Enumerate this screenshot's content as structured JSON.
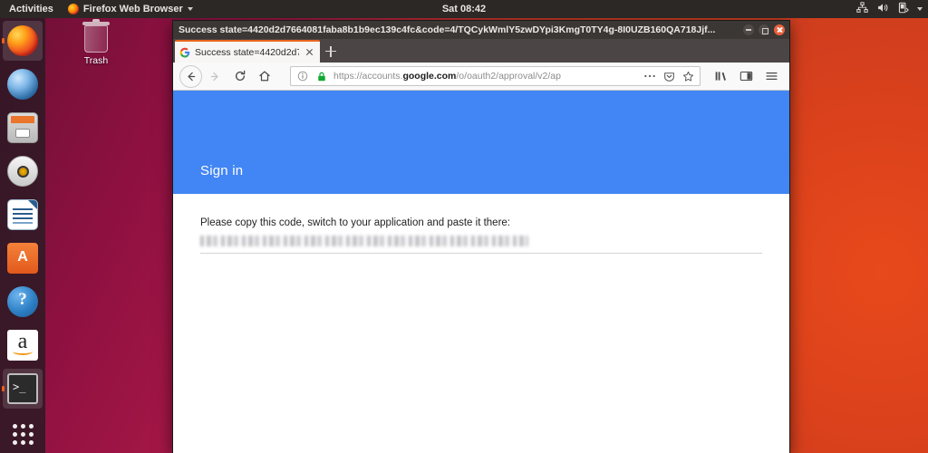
{
  "topbar": {
    "activities": "Activities",
    "app_menu": "Firefox Web Browser",
    "clock": "Sat 08:42",
    "tray_icons": [
      "network-icon",
      "volume-icon",
      "power-icon",
      "chevron-down-icon"
    ]
  },
  "dock": {
    "items": [
      {
        "label": "Firefox Web Browser",
        "icon": "firefox-icon",
        "active": true
      },
      {
        "label": "Thunderbird Mail",
        "icon": "thunderbird-icon",
        "active": false
      },
      {
        "label": "Files",
        "icon": "files-icon",
        "active": false
      },
      {
        "label": "Rhythmbox",
        "icon": "rhythmbox-icon",
        "active": false
      },
      {
        "label": "LibreOffice Writer",
        "icon": "writer-icon",
        "active": false
      },
      {
        "label": "Ubuntu Software",
        "icon": "ubuntu-software-icon",
        "active": false
      },
      {
        "label": "Help",
        "icon": "help-icon",
        "active": false
      },
      {
        "label": "Amazon",
        "icon": "amazon-icon",
        "active": false
      },
      {
        "label": "Terminal",
        "icon": "terminal-icon",
        "active": true
      }
    ],
    "show_applications": "Show Applications"
  },
  "desktop": {
    "trash_label": "Trash"
  },
  "window": {
    "title": "Success state=4420d2d7664081faba8b1b9ec139c4fc&code=4/TQCykWmlY5zwDYpi3KmgT0TY4g-8I0UZB160QA718Jjf...",
    "controls": {
      "minimize": "minimize-button",
      "maximize": "maximize-button",
      "close": "close-button"
    }
  },
  "browser": {
    "tab": {
      "title": "Success state=4420d2d7",
      "favicon": "google-favicon",
      "close_label": "Close tab"
    },
    "new_tab_label": "New tab",
    "nav": {
      "back": "back-button",
      "forward": "forward-button",
      "reload": "reload-button",
      "home": "home-button"
    },
    "urlbar": {
      "url_prefix": "https://accounts.",
      "url_domain": "google.com",
      "url_suffix": "/o/oauth2/approval/v2/ap",
      "full_url": "https://accounts.google.com/o/oauth2/approval/v2/ap",
      "identity_icon": "info-icon",
      "lock_icon": "padlock-icon",
      "page_actions": "ellipsis-icon",
      "pocket_icon": "pocket-icon",
      "bookmark_icon": "star-icon"
    },
    "toolbar_right": {
      "library": "library-icon",
      "sidebar": "sidebar-icon",
      "menu": "hamburger-menu-icon"
    }
  },
  "page": {
    "header_title": "Sign in",
    "instruction": "Please copy this code, switch to your application and paste it there:",
    "code_value": "",
    "code_redacted": true
  },
  "colors": {
    "google_blue": "#4285f4",
    "firefox_orange": "#e9661f",
    "ubuntu_purple": "#2c001e",
    "lock_green": "#12a832"
  }
}
